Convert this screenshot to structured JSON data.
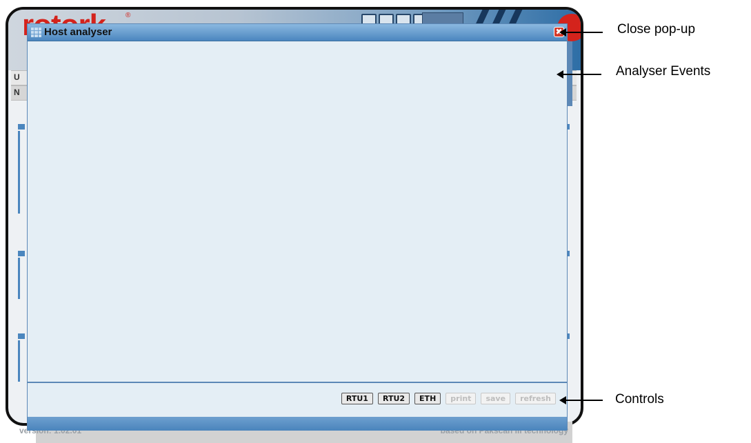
{
  "popup": {
    "title": "Host analyser",
    "close_symbol": "✖",
    "controls": [
      {
        "label": "RTU1",
        "enabled": true
      },
      {
        "label": "RTU2",
        "enabled": true
      },
      {
        "label": "ETH",
        "enabled": true
      },
      {
        "label": "print",
        "enabled": false
      },
      {
        "label": "save",
        "enabled": false
      },
      {
        "label": "refresh",
        "enabled": false
      }
    ]
  },
  "background_app": {
    "brand": "rotork",
    "tab1_letter": "U",
    "tab2_letter": "N",
    "footer_version": "version: 1.02.01",
    "footer_tech": "based on Pakscan III technology"
  },
  "callouts": {
    "close": "Close pop-up",
    "events": "Analyser Events",
    "controls": "Controls"
  },
  "colors": {
    "titlebar": "#4b86bf",
    "panel_bg": "#e4eef5",
    "brand_red": "#d4231c"
  },
  "icons": {
    "title_icon": "grid-icon",
    "close": "close-icon"
  }
}
